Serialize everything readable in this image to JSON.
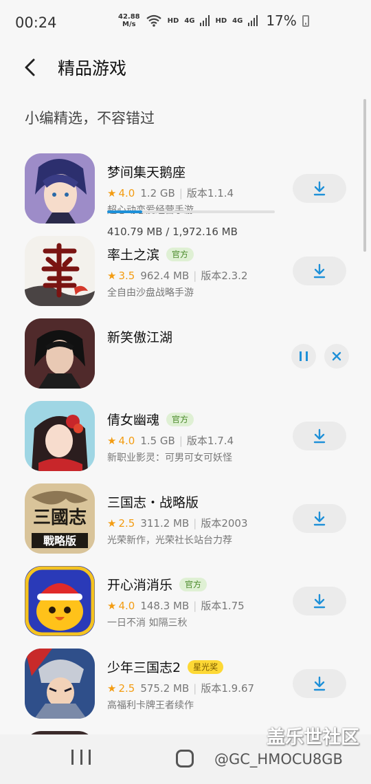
{
  "status_bar": {
    "time": "00:24",
    "speed_value": "42.88",
    "speed_unit": "M/s",
    "hd1": "HD",
    "net1": "4G",
    "hd2": "HD",
    "net2": "4G",
    "battery": "17%"
  },
  "header": {
    "title": "精品游戏"
  },
  "subtitle": "小编精选，不容错过",
  "apps": [
    {
      "name": "梦间集天鹅座",
      "badge": "",
      "rating": "4.0",
      "size": "1.2 GB",
      "version": "版本1.1.4",
      "desc": "超心动恋爱经营手游",
      "icon": "anime-boy-icon",
      "state": "download"
    },
    {
      "name": "率土之滨",
      "badge": "官方",
      "rating": "3.5",
      "size": "962.4 MB",
      "version": "版本2.3.2",
      "desc": "全自由沙盘战略手游",
      "icon": "calligraphy-icon",
      "state": "download"
    },
    {
      "name": "新笑傲江湖",
      "badge": "",
      "progress_text": "410.79 MB / 1,972.16 MB",
      "progress": 0.2083,
      "icon": "swordsman-icon",
      "state": "downloading"
    },
    {
      "name": "倩女幽魂",
      "badge": "官方",
      "rating": "4.0",
      "size": "1.5 GB",
      "version": "版本1.7.4",
      "desc": "新职业影灵：可男可女可妖怪",
      "icon": "heroine-icon",
      "state": "download"
    },
    {
      "name": "三国志・战略版",
      "badge": "",
      "rating": "2.5",
      "size": "311.2 MB",
      "version": "版本2003",
      "desc": "光荣新作，光荣社长站台力荐",
      "icon": "three-kingdoms-icon",
      "state": "download"
    },
    {
      "name": "开心消消乐",
      "badge": "官方",
      "rating": "4.0",
      "size": "148.3 MB",
      "version": "版本1.75",
      "desc": "一日不消 如隔三秋",
      "icon": "chick-icon",
      "state": "download"
    },
    {
      "name": "少年三国志2",
      "badge": "星光奖",
      "rating": "2.5",
      "size": "575.2 MB",
      "version": "版本1.9.67",
      "desc": "高福利卡牌王者续作",
      "icon": "warrior-icon",
      "state": "download"
    }
  ],
  "watermark": {
    "title": "盖乐世社区",
    "handle": "@GC_HMOCU8GB"
  },
  "colors": {
    "accent": "#1e90d8",
    "rating": "#f39c12",
    "background": "#f7f7f7"
  }
}
